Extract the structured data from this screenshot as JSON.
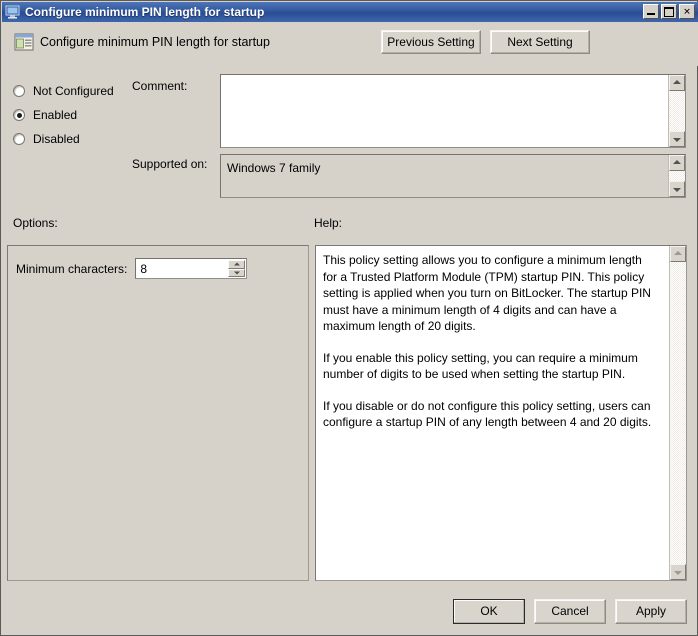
{
  "window": {
    "title": "Configure minimum PIN length for startup",
    "icon": "computer-policy-icon",
    "minimize_label": "_",
    "maximize_label": "□",
    "close_label": "×"
  },
  "header": {
    "icon": "policy-setting-icon",
    "title": "Configure minimum PIN length for startup",
    "previous_setting": "Previous Setting",
    "next_setting": "Next Setting"
  },
  "state": {
    "options": [
      {
        "label": "Not Configured",
        "selected": false
      },
      {
        "label": "Enabled",
        "selected": true
      },
      {
        "label": "Disabled",
        "selected": false
      }
    ],
    "selected": "Enabled"
  },
  "comment": {
    "label": "Comment:",
    "value": ""
  },
  "supported_on": {
    "label": "Supported on:",
    "value": "Windows 7 family"
  },
  "options_panel": {
    "label": "Options:",
    "minimum_characters_label": "Minimum characters:",
    "minimum_characters_value": "8"
  },
  "help_panel": {
    "label": "Help:",
    "paragraphs": [
      "This policy setting allows you to configure a minimum length for a Trusted Platform Module (TPM) startup PIN. This policy setting is applied when you turn on BitLocker. The startup PIN must have a minimum length of 4 digits and can have a maximum length of 20 digits.",
      "If you enable this policy setting, you can require a minimum number of digits to be used when setting the startup PIN.",
      "If you disable or do not configure this policy setting, users can configure a startup PIN of any length between 4 and 20 digits."
    ]
  },
  "footer": {
    "ok": "OK",
    "cancel": "Cancel",
    "apply": "Apply"
  },
  "colors": {
    "titlebar_start": "#4f75b8",
    "titlebar_end": "#2a4d95",
    "window_background": "#d6d2ca",
    "field_background": "#ffffff",
    "text": "#000000"
  }
}
